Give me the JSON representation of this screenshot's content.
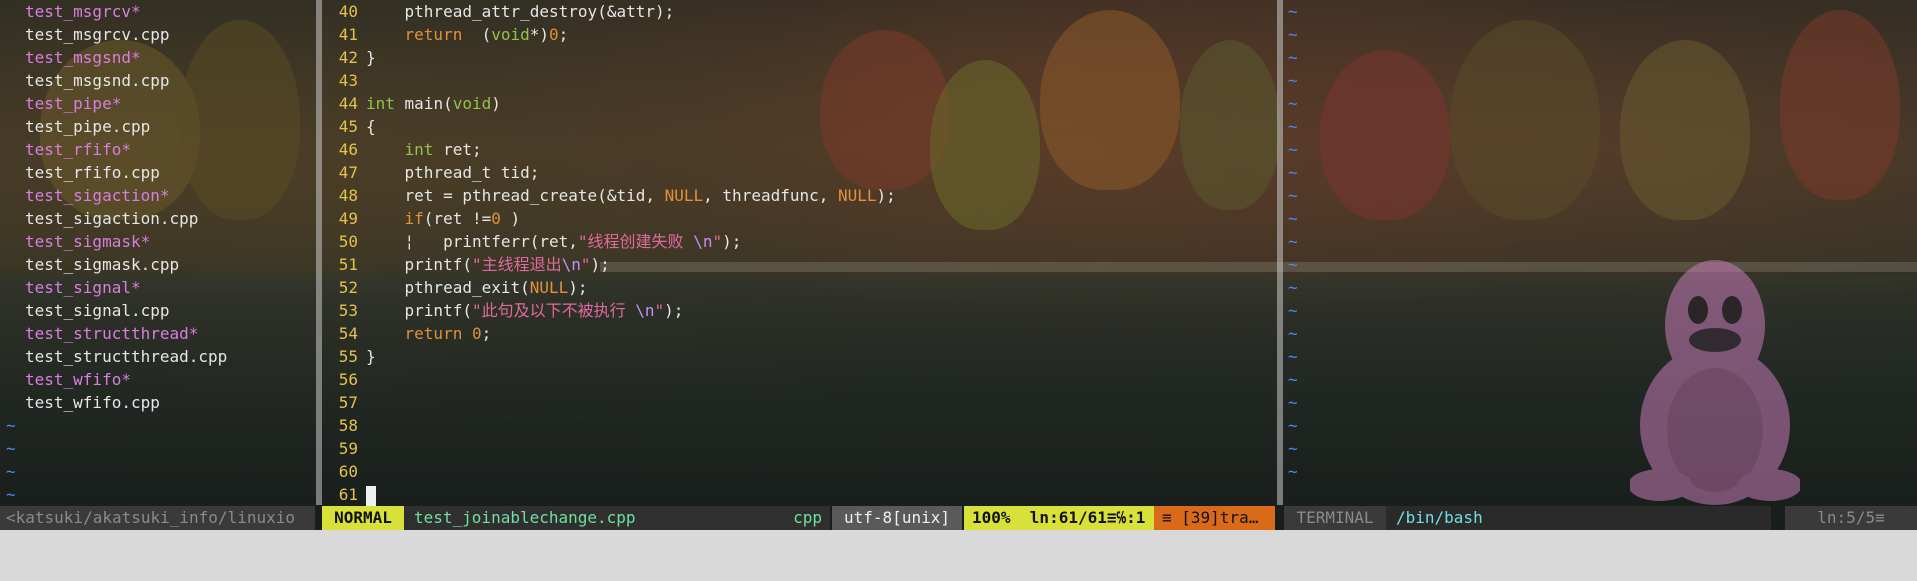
{
  "file_browser": {
    "entries": [
      {
        "name": "test_msgrcv*",
        "exec": true
      },
      {
        "name": "test_msgrcv.cpp",
        "exec": false
      },
      {
        "name": "test_msgsnd*",
        "exec": true
      },
      {
        "name": "test_msgsnd.cpp",
        "exec": false
      },
      {
        "name": "test_pipe*",
        "exec": true
      },
      {
        "name": "test_pipe.cpp",
        "exec": false
      },
      {
        "name": "test_rfifo*",
        "exec": true
      },
      {
        "name": "test_rfifo.cpp",
        "exec": false
      },
      {
        "name": "test_sigaction*",
        "exec": true
      },
      {
        "name": "test_sigaction.cpp",
        "exec": false
      },
      {
        "name": "test_sigmask*",
        "exec": true
      },
      {
        "name": "test_sigmask.cpp",
        "exec": false
      },
      {
        "name": "test_signal*",
        "exec": true
      },
      {
        "name": "test_signal.cpp",
        "exec": false
      },
      {
        "name": "test_structthread*",
        "exec": true
      },
      {
        "name": "test_structthread.cpp",
        "exec": false
      },
      {
        "name": "test_wfifo*",
        "exec": true
      },
      {
        "name": "test_wfifo.cpp",
        "exec": false
      }
    ],
    "filler": "~"
  },
  "editor": {
    "lines": [
      {
        "n": "40",
        "parts": [
          [
            "    pthread_attr_destroy(&attr);",
            ""
          ]
        ]
      },
      {
        "n": "41",
        "parts": [
          [
            "    ",
            ""
          ],
          [
            "return",
            "ret"
          ],
          [
            "  (",
            ""
          ],
          [
            "void",
            "kw"
          ],
          [
            "*)",
            ""
          ],
          [
            "0",
            "const"
          ],
          [
            ";",
            ""
          ]
        ]
      },
      {
        "n": "42",
        "parts": [
          [
            "}",
            ""
          ]
        ]
      },
      {
        "n": "43",
        "parts": []
      },
      {
        "n": "44",
        "parts": [
          [
            "int",
            "kw"
          ],
          [
            " main(",
            ""
          ],
          [
            "void",
            "kw"
          ],
          [
            ")",
            ""
          ]
        ]
      },
      {
        "n": "45",
        "parts": [
          [
            "{",
            ""
          ]
        ]
      },
      {
        "n": "46",
        "parts": [
          [
            "    ",
            ""
          ],
          [
            "int",
            "kw"
          ],
          [
            " ret;",
            ""
          ]
        ]
      },
      {
        "n": "47",
        "parts": [
          [
            "    pthread_t tid;",
            ""
          ]
        ]
      },
      {
        "n": "48",
        "parts": [
          [
            "    ret = pthread_create(&tid, ",
            ""
          ],
          [
            "NULL",
            "const"
          ],
          [
            ", threadfunc, ",
            ""
          ],
          [
            "NULL",
            "const"
          ],
          [
            ");",
            ""
          ]
        ]
      },
      {
        "n": "49",
        "parts": [
          [
            "    ",
            ""
          ],
          [
            "if",
            "ret"
          ],
          [
            "(ret !=",
            ""
          ],
          [
            "0",
            "const"
          ],
          [
            " )",
            ""
          ]
        ]
      },
      {
        "n": "50",
        "parts": [
          [
            "    ¦   printferr(ret,",
            ""
          ],
          [
            "\"线程创建失败 ",
            "str"
          ],
          [
            "\\n",
            "esc"
          ],
          [
            "\"",
            "str"
          ],
          [
            ");",
            ""
          ]
        ]
      },
      {
        "n": "51",
        "parts": [
          [
            "    printf(",
            ""
          ],
          [
            "\"主线程退出",
            "str"
          ],
          [
            "\\n",
            "esc"
          ],
          [
            "\"",
            "str"
          ],
          [
            ");",
            ""
          ]
        ]
      },
      {
        "n": "52",
        "parts": [
          [
            "    pthread_exit(",
            ""
          ],
          [
            "NULL",
            "const"
          ],
          [
            ");",
            ""
          ]
        ]
      },
      {
        "n": "53",
        "parts": [
          [
            "    printf(",
            ""
          ],
          [
            "\"此句及以下不被执行 ",
            "str"
          ],
          [
            "\\n",
            "esc"
          ],
          [
            "\"",
            "str"
          ],
          [
            ");",
            ""
          ]
        ]
      },
      {
        "n": "54",
        "parts": [
          [
            "    ",
            ""
          ],
          [
            "return",
            "ret"
          ],
          [
            " ",
            ""
          ],
          [
            "0",
            "const"
          ],
          [
            ";",
            ""
          ]
        ]
      },
      {
        "n": "55",
        "parts": [
          [
            "}",
            ""
          ]
        ]
      },
      {
        "n": "56",
        "parts": []
      },
      {
        "n": "57",
        "parts": []
      },
      {
        "n": "58",
        "parts": []
      },
      {
        "n": "59",
        "parts": []
      },
      {
        "n": "60",
        "parts": []
      },
      {
        "n": "61",
        "parts": [],
        "cursor": true
      }
    ]
  },
  "terminal": {
    "filler": "~",
    "rows": 21
  },
  "status": {
    "left_path": "<katsuki/akatsuki_info/linuxio",
    "mode": "NORMAL",
    "filename": "test_joinablechange.cpp",
    "filetype": "cpp",
    "encoding": "utf-8[unix]",
    "position": "100%  ln:61/61≡℅:1",
    "warning": "≡ [39]tra…",
    "terminal_label": "TERMINAL",
    "shell": "/bin/bash",
    "terminal_position": "ln:5/5≡"
  }
}
